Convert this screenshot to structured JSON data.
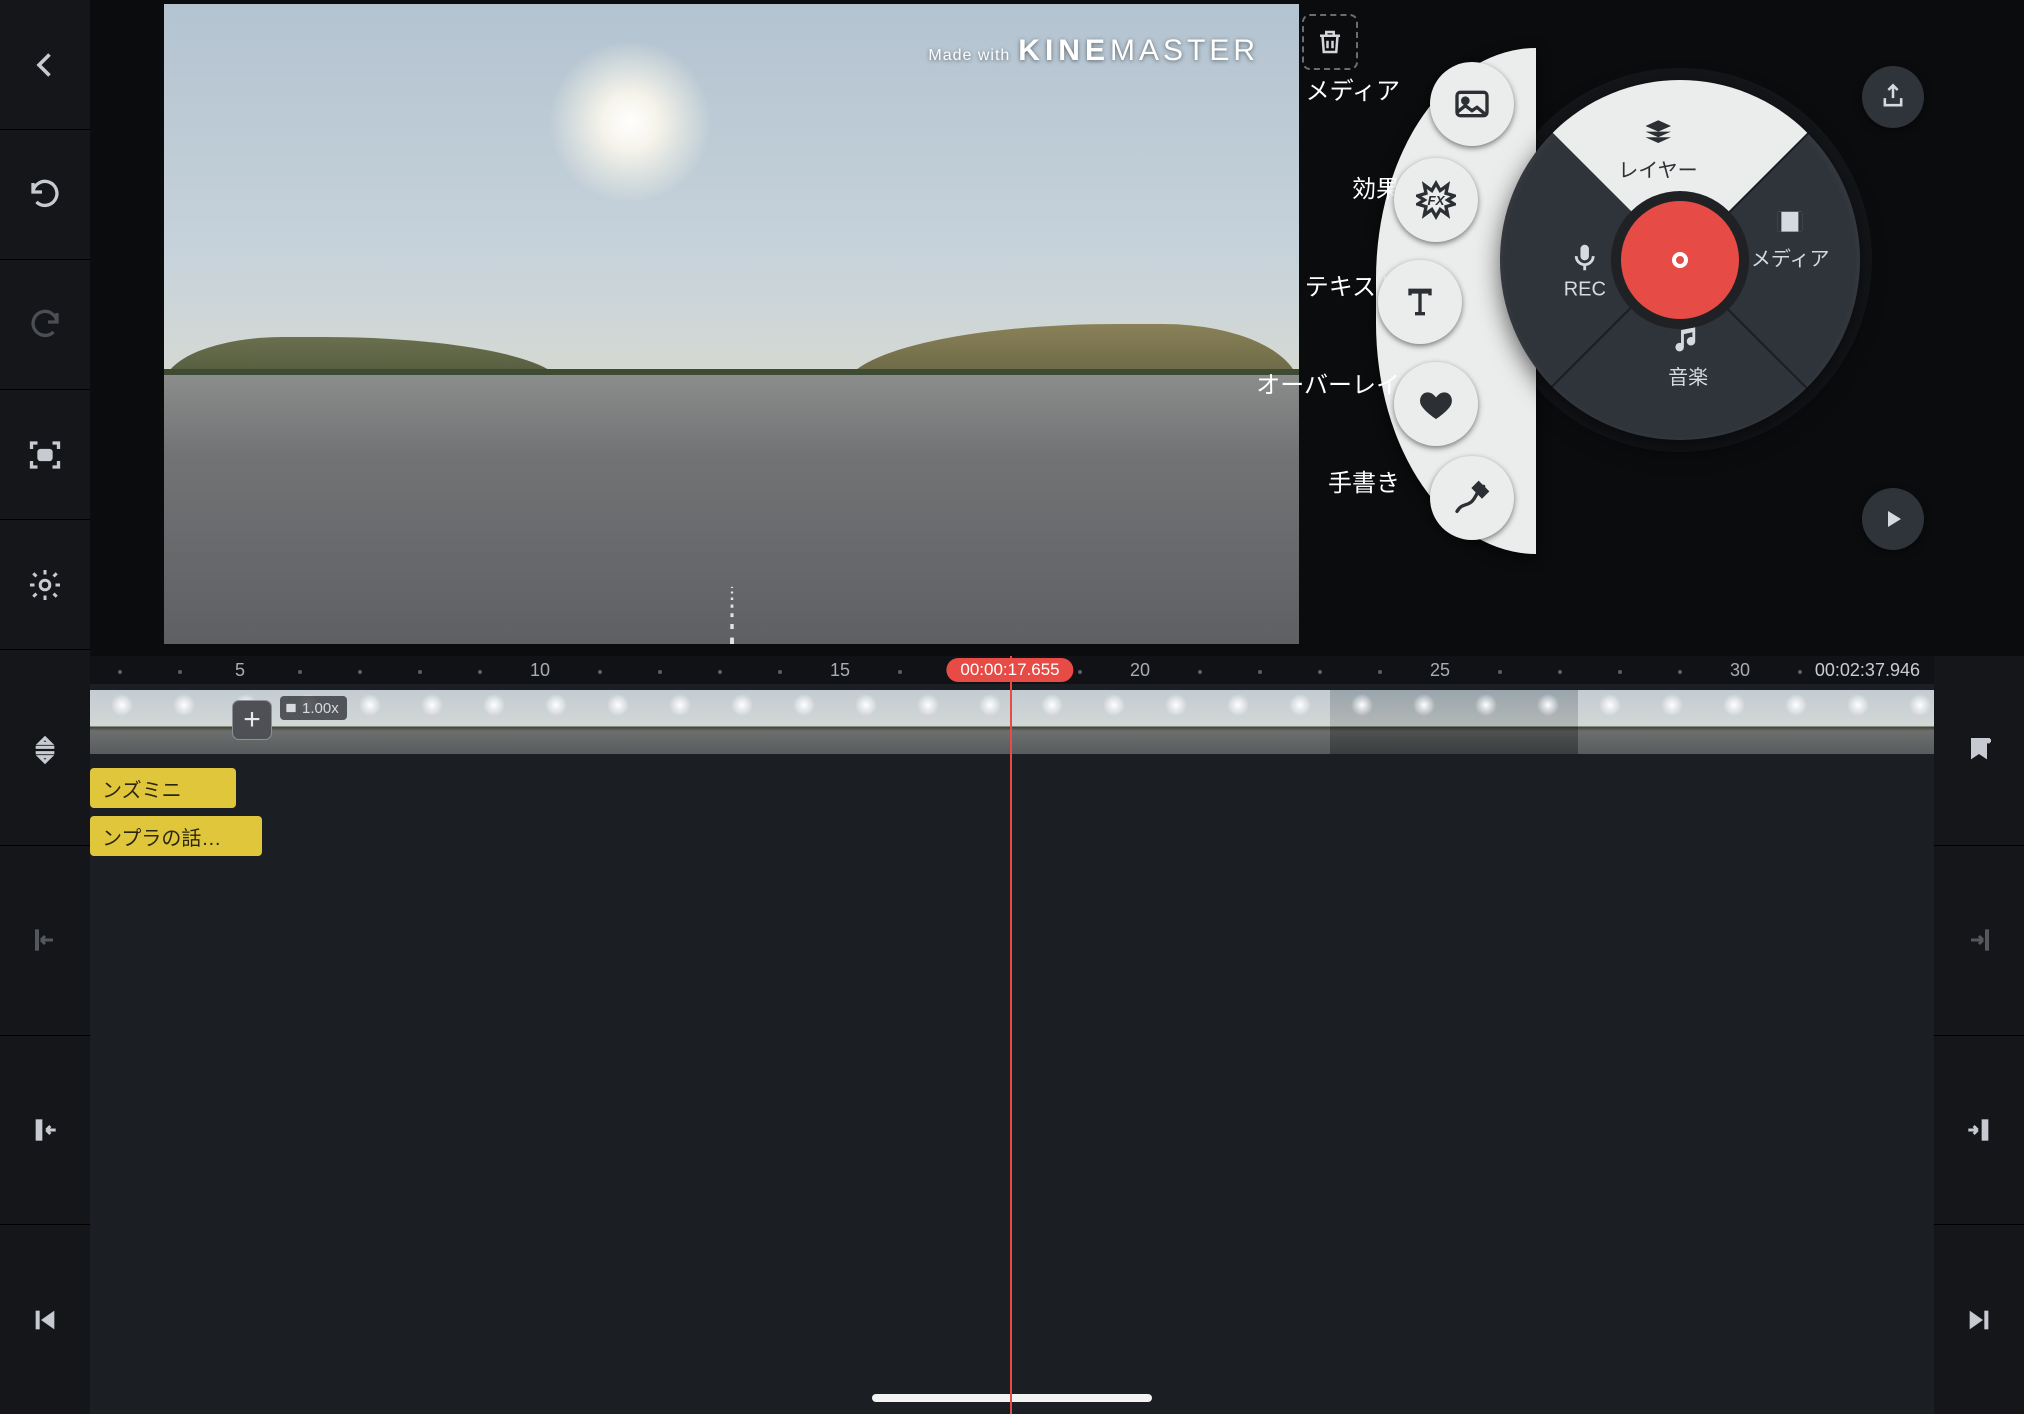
{
  "watermark": {
    "prefix": "Made with",
    "brand_bold": "KINE",
    "brand_light": "MASTER"
  },
  "layer_menu": {
    "labels": [
      "メディア",
      "効果",
      "テキスト",
      "オーバーレイ",
      "手書き"
    ]
  },
  "wheel": {
    "top": "メディア",
    "right": "音楽",
    "bottom": "REC",
    "left": "レイヤー"
  },
  "timeline": {
    "playhead": "00:00:17.655",
    "total": "00:02:37.946",
    "ruler_seconds": [
      5,
      10,
      15,
      20,
      25,
      30
    ],
    "clip_speed": "1.00x",
    "layer_clips": [
      "ンズミニ",
      "ンプラの話…"
    ]
  }
}
